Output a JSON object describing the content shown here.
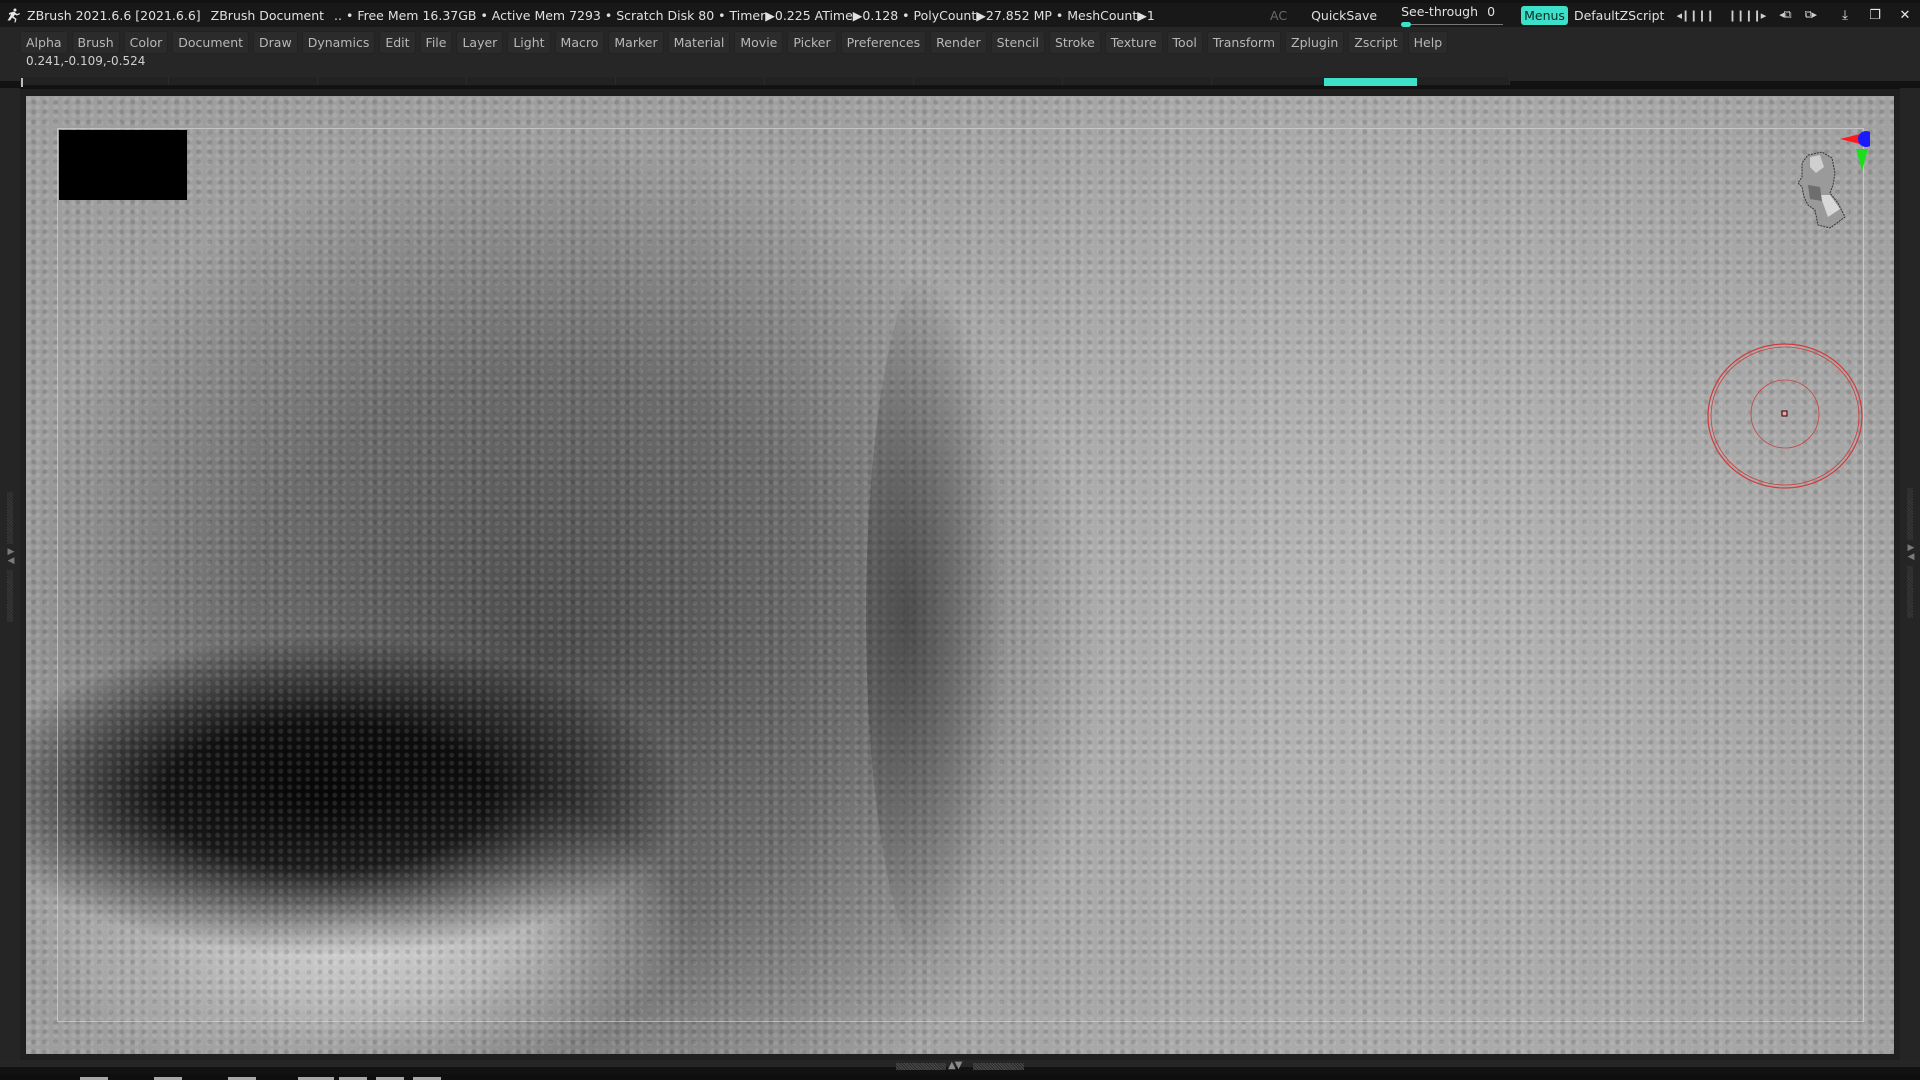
{
  "titlebar": {
    "app_title": "ZBrush 2021.6.6 [2021.6.6]",
    "document": "ZBrush Document",
    "stats": ".. • Free Mem 16.37GB • Active Mem 7293 • Scratch Disk 80 •  Timer▶0.225 ATime▶0.128 • PolyCount▶27.852 MP  • MeshCount▶1",
    "ac_label": "AC",
    "quicksave_label": "QuickSave",
    "seethrough_label": "See-through",
    "seethrough_value": "0",
    "menus_label": "Menus",
    "script_label": "DefaultZScript",
    "accent_color": "#3de0c8"
  },
  "menubar": {
    "items": [
      "Alpha",
      "Brush",
      "Color",
      "Document",
      "Draw",
      "Dynamics",
      "Edit",
      "File",
      "Layer",
      "Light",
      "Macro",
      "Marker",
      "Material",
      "Movie",
      "Picker",
      "Preferences",
      "Render",
      "Stencil",
      "Stroke",
      "Texture",
      "Tool",
      "Transform",
      "Zplugin",
      "Zscript",
      "Help"
    ]
  },
  "coords_readout": "0.241,-0.109,-0.524",
  "icons": {
    "logo": "zbrush-logo-icon",
    "interface_left": "◂❙❙❙❙",
    "interface_right": "❙❙❙❙▸",
    "layout_left": "◂⧉",
    "layout_right": "⧉▸",
    "minimize": "⤓",
    "restore": "❐",
    "close": "✕",
    "tray_arrows_v": "▶◀",
    "bottom_arrows": "▲▼"
  }
}
